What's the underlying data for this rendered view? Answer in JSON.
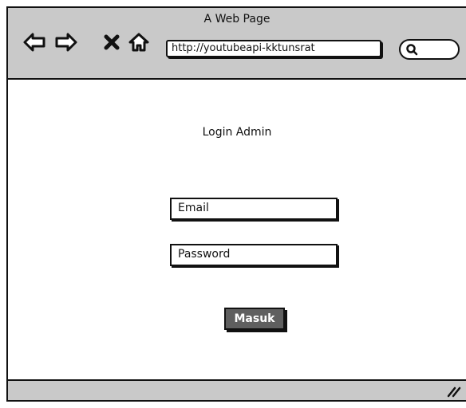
{
  "window": {
    "title": "A Web Page"
  },
  "toolbar": {
    "back_icon": "arrow-left-icon",
    "forward_icon": "arrow-right-icon",
    "stop_icon": "close-icon",
    "home_icon": "home-icon",
    "url": "http://youtubeapi-kktunsrat",
    "search_icon": "search-icon"
  },
  "login": {
    "heading": "Login Admin",
    "email_placeholder": "Email",
    "password_placeholder": "Password",
    "submit_label": "Masuk"
  },
  "colors": {
    "chrome": "#c9c9c9",
    "button": "#5f5f5f",
    "outline": "#111111"
  }
}
